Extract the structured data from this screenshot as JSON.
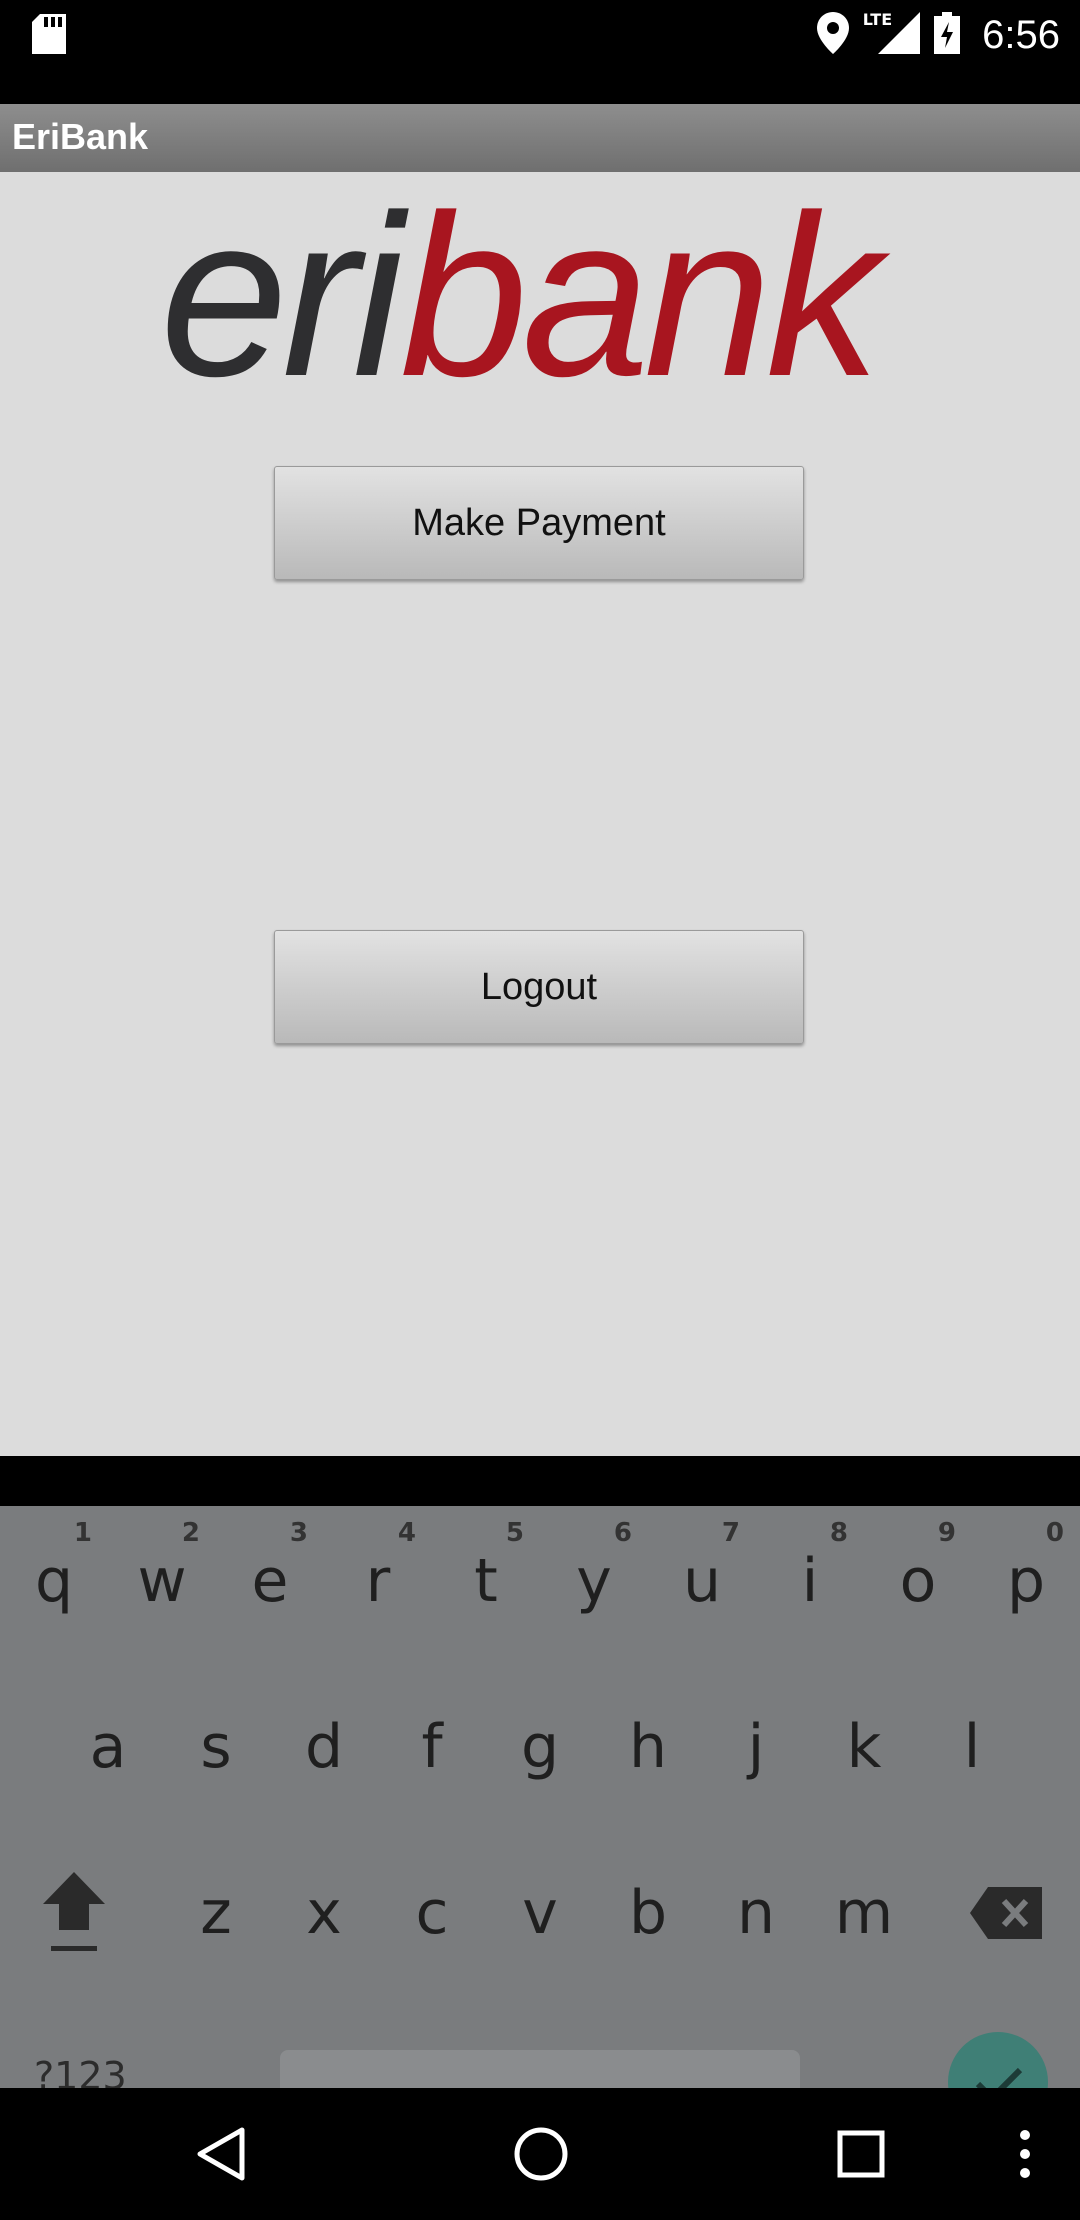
{
  "status_bar": {
    "time": "6:56",
    "network": "LTE",
    "icons": [
      "sd-card-icon",
      "location-icon",
      "signal-icon",
      "battery-charging-icon"
    ]
  },
  "app_bar": {
    "title": "EriBank"
  },
  "logo": {
    "text_dark": "eri",
    "text_red": "bank",
    "colors": {
      "dark": "#2e2e30",
      "red": "#a8151f"
    }
  },
  "buttons": {
    "make_payment": "Make Payment",
    "logout": "Logout"
  },
  "keyboard": {
    "row1": [
      {
        "key": "q",
        "hint": "1"
      },
      {
        "key": "w",
        "hint": "2"
      },
      {
        "key": "e",
        "hint": "3"
      },
      {
        "key": "r",
        "hint": "4"
      },
      {
        "key": "t",
        "hint": "5"
      },
      {
        "key": "y",
        "hint": "6"
      },
      {
        "key": "u",
        "hint": "7"
      },
      {
        "key": "i",
        "hint": "8"
      },
      {
        "key": "o",
        "hint": "9"
      },
      {
        "key": "p",
        "hint": "0"
      }
    ],
    "row2": [
      "a",
      "s",
      "d",
      "f",
      "g",
      "h",
      "j",
      "k",
      "l"
    ],
    "row3": [
      "z",
      "x",
      "c",
      "v",
      "b",
      "n",
      "m"
    ],
    "symbols_key": "?123",
    "icons": [
      "shift-icon",
      "backspace-icon",
      "enter-check-icon"
    ]
  },
  "nav_bar": {
    "icons": [
      "back-icon",
      "home-icon",
      "recents-icon",
      "more-icon"
    ]
  }
}
